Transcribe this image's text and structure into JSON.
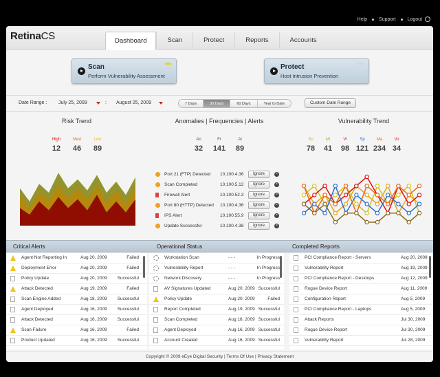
{
  "toplinks": {
    "help": "Help",
    "support": "Support",
    "logout": "Logout"
  },
  "logo": {
    "part1": "Retina",
    "part2": "CS"
  },
  "tabs": [
    {
      "label": "Dashboard",
      "active": true
    },
    {
      "label": "Scan"
    },
    {
      "label": "Protect"
    },
    {
      "label": "Reports"
    },
    {
      "label": "Accounts"
    }
  ],
  "actions": {
    "scan": {
      "title": "Scan",
      "subtitle": "Perform Vulnerability Assessment",
      "flag_color": "#e8d22a"
    },
    "protect": {
      "title": "Protect",
      "subtitle": "Host Intrusion Prevention",
      "flag_color": "#cfd8e0"
    }
  },
  "daterange": {
    "label": "Date Range :",
    "from": "July 25, 2009",
    "to": "August 25, 2009",
    "ranges": [
      "7 Days",
      "30 Days",
      "60 Days",
      "Year to Date"
    ],
    "active_range": "30 Days",
    "custom": "Custom Date Range"
  },
  "risk": {
    "title": "Risk Trend",
    "stats": [
      {
        "label": "High",
        "value": "12",
        "color": "#d11"
      },
      {
        "label": "Med",
        "value": "46",
        "color": "#e8681a"
      },
      {
        "label": "Low",
        "value": "89",
        "color": "#e6c21a"
      }
    ]
  },
  "anomalies": {
    "title_a": "Anomalies",
    "title_f": "Frequencies",
    "title_al": "Alerts",
    "stats": [
      {
        "label": "An",
        "value": "32"
      },
      {
        "label": "Fr",
        "value": "141"
      },
      {
        "label": "Al",
        "value": "89"
      }
    ],
    "rows": [
      {
        "name": "Port 21 (FTP) Detected",
        "ip": "10.100.4.36",
        "icon": "warning-icon",
        "action": "Ignore"
      },
      {
        "name": "Scan Completed",
        "ip": "10.100.5.12",
        "icon": "status-icon",
        "action": "Ignore"
      },
      {
        "name": "Firewall Alert",
        "ip": "10.100.52.3",
        "icon": "flag-icon",
        "action": "Ignore"
      },
      {
        "name": "Port 80 (HTTP) Detected",
        "ip": "10.100.4.36",
        "icon": "warning-icon",
        "action": "Ignore"
      },
      {
        "name": "IPS Alert",
        "ip": "10.100.55.9",
        "icon": "flag-icon",
        "action": "Ignore"
      },
      {
        "name": "Update Successful",
        "ip": "10.100.4.38",
        "icon": "status-icon",
        "action": "Ignore"
      }
    ]
  },
  "vuln": {
    "title": "Vulnerability Trend",
    "stats": [
      {
        "label": "Su",
        "value": "78",
        "color": "#e6a21a"
      },
      {
        "label": "Mi",
        "value": "41",
        "color": "#c9a800"
      },
      {
        "label": "Vi",
        "value": "98",
        "color": "#d11"
      },
      {
        "label": "Sp",
        "value": "121",
        "color": "#2a6fd6"
      },
      {
        "label": "Ma",
        "value": "234",
        "color": "#e8681a"
      },
      {
        "label": "Vo",
        "value": "34",
        "color": "#c22"
      }
    ]
  },
  "chart_data": [
    {
      "type": "area",
      "title": "Risk Trend",
      "x": [
        0,
        1,
        2,
        3,
        4,
        5,
        6,
        7,
        8,
        9,
        10,
        11,
        12
      ],
      "series": [
        {
          "name": "Low",
          "color": "#8a8a1a",
          "values": [
            34,
            22,
            38,
            30,
            48,
            34,
            42,
            32,
            46,
            30,
            40,
            28,
            44
          ]
        },
        {
          "name": "Med",
          "color": "#b8860b",
          "values": [
            26,
            16,
            30,
            24,
            36,
            26,
            34,
            24,
            36,
            22,
            32,
            20,
            34
          ]
        },
        {
          "name": "High",
          "color": "#8b0000",
          "values": [
            16,
            10,
            22,
            14,
            26,
            16,
            24,
            14,
            28,
            12,
            22,
            12,
            24
          ]
        }
      ],
      "ylim": [
        0,
        50
      ]
    },
    {
      "type": "line",
      "title": "Vulnerability Trend",
      "x": [
        0,
        1,
        2,
        3,
        4,
        5,
        6,
        7,
        8,
        9,
        10,
        11
      ],
      "series": [
        {
          "name": "Su",
          "color": "#e6a21a",
          "values": [
            4,
            2,
            3,
            1,
            2,
            4,
            3,
            2,
            4,
            1,
            3,
            2
          ]
        },
        {
          "name": "Mi",
          "color": "#d6c21a",
          "values": [
            3,
            4,
            2,
            3,
            4,
            2,
            1,
            4,
            2,
            3,
            4,
            1
          ]
        },
        {
          "name": "Vi",
          "color": "#d11",
          "values": [
            2,
            3,
            4,
            2,
            3,
            4,
            5,
            3,
            1,
            4,
            2,
            3
          ]
        },
        {
          "name": "Sp",
          "color": "#2a6fd6",
          "values": [
            1,
            2,
            1,
            4,
            1,
            3,
            2,
            1,
            3,
            2,
            1,
            2
          ]
        },
        {
          "name": "Ma",
          "color": "#e8681a",
          "values": [
            4,
            1,
            3,
            2,
            4,
            1,
            4,
            3,
            2,
            4,
            3,
            4
          ]
        },
        {
          "name": "Vo",
          "color": "#8a6a1a",
          "values": [
            2,
            1,
            2,
            0,
            1,
            1,
            0,
            0,
            1,
            1,
            0,
            1
          ]
        }
      ],
      "ylim": [
        0,
        5
      ]
    }
  ],
  "critical": {
    "title": "Critical Alerts",
    "rows": [
      {
        "name": "Agent Not Reporting In",
        "date": "Aug 20, 2009",
        "status": "Failed",
        "icon": "warning-icon"
      },
      {
        "name": "Deployment Error",
        "date": "Aug 20, 2009",
        "status": "Failed",
        "icon": "warning-icon"
      },
      {
        "name": "Policy Update",
        "date": "Aug 20, 2009",
        "status": "Successful",
        "icon": "doc-icon"
      },
      {
        "name": "Attack Detected",
        "date": "Aug 19, 2009",
        "status": "Failed",
        "icon": "warning-icon"
      },
      {
        "name": "Scan Engine Added",
        "date": "Aug 18, 2009",
        "status": "Successful",
        "icon": "doc-icon"
      },
      {
        "name": "Agent Deployed",
        "date": "Aug 16, 2009",
        "status": "Successful",
        "icon": "doc-icon"
      },
      {
        "name": "Attack Detected",
        "date": "Aug 16, 2009",
        "status": "Successful",
        "icon": "doc-icon"
      },
      {
        "name": "Scan Failure",
        "date": "Aug 16, 2009",
        "status": "Failed",
        "icon": "warning-icon"
      },
      {
        "name": "Product Updated",
        "date": "Aug 16, 2009",
        "status": "Successful",
        "icon": "doc-icon"
      }
    ]
  },
  "operational": {
    "title": "Operational Status",
    "rows": [
      {
        "name": "Workstation Scan",
        "date": "- - -",
        "status": "In Progress",
        "icon": "spinner-icon"
      },
      {
        "name": "Vulnerability Report",
        "date": "- - -",
        "status": "In Progress",
        "icon": "spinner-icon"
      },
      {
        "name": "Network Discovery",
        "date": "- - -",
        "status": "In Progress",
        "icon": "spinner-icon"
      },
      {
        "name": "AV Signatures Updated",
        "date": "Aug 20, 2009",
        "status": "Successful",
        "icon": "doc-icon"
      },
      {
        "name": "Policy Update",
        "date": "Aug 20, 2009",
        "status": "Failed",
        "icon": "warning-icon"
      },
      {
        "name": "Report Completed",
        "date": "Aug 19, 2009",
        "status": "Successful",
        "icon": "doc-icon"
      },
      {
        "name": "Scan Completed",
        "date": "Aug 18, 2009",
        "status": "Successful",
        "icon": "doc-icon"
      },
      {
        "name": "Agent Deployed",
        "date": "Aug 16, 2009",
        "status": "Successful",
        "icon": "doc-icon"
      },
      {
        "name": "Account Created",
        "date": "Aug 16, 2009",
        "status": "Successful",
        "icon": "doc-icon"
      }
    ]
  },
  "completed": {
    "title": "Completed Reports",
    "rows": [
      {
        "name": "PCI Compliance Report - Servers",
        "date": "Aug 20, 2009"
      },
      {
        "name": "Vulnerability Report",
        "date": "Aug 19, 2009"
      },
      {
        "name": "PCI Compliance Report - Desktops",
        "date": "Aug 12, 2009"
      },
      {
        "name": "Rogue Device Report",
        "date": "Aug 11, 2009"
      },
      {
        "name": "Configuration Report",
        "date": "Aug 5, 2009"
      },
      {
        "name": "PCI Compliance Report - Laptops",
        "date": "Aug 5, 2009"
      },
      {
        "name": "Attack Reports",
        "date": "Jul 30, 2009"
      },
      {
        "name": "Rogue Device Report",
        "date": "Jul 30, 2009"
      },
      {
        "name": "Vulnerability Report",
        "date": "Jul 28, 2009"
      }
    ]
  },
  "footer": {
    "copyright": "Copyright © 2009 eEye Digital Security",
    "terms": "Terms Of Use",
    "privacy": "Privacy Statement"
  }
}
